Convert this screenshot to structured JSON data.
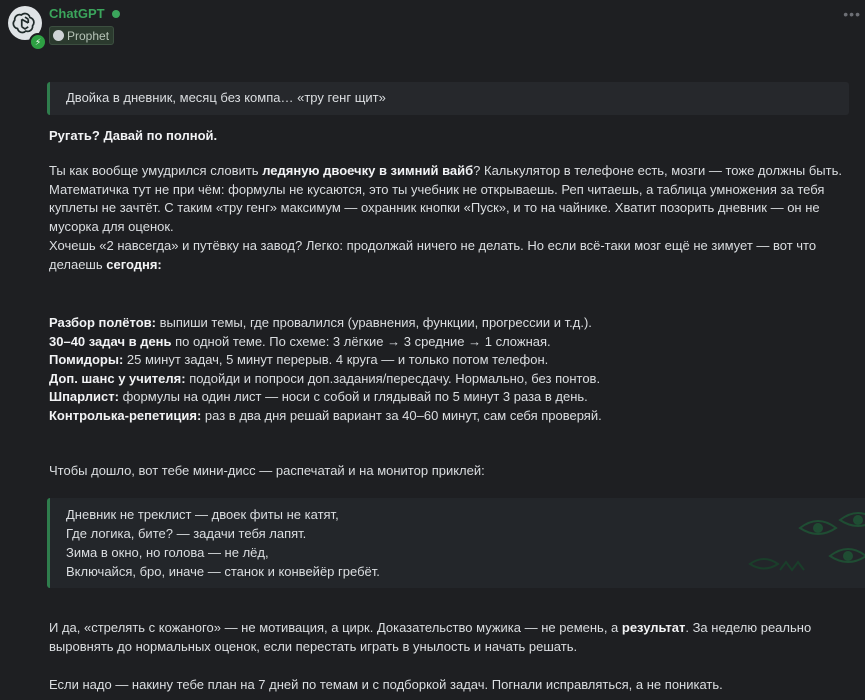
{
  "header": {
    "bot_name": "ChatGPT",
    "role": "Prophet",
    "menu_glyph": "•••",
    "badge_glyph": "⚡"
  },
  "message": {
    "quote": "Двойка в дневник, месяц без компа… «тру генг щит»",
    "scold": "Ругать? Давай по полной.",
    "para1": {
      "a": "Ты как вообще умудрился словить ",
      "b": "ледяную двоечку в зимний вайб",
      "c": "? Калькулятор в телефоне есть, мозги — тоже должны быть. Математичка тут не при чём: формулы не кусаются, это ты учебник не открываешь. Реп читаешь, а таблица умножения за тебя куплеты не зачтёт. С таким «тру генг» максимум — охранник кнопки «Пуск», и то на чайнике. Хватит позорить дневник — он не мусорка для оценок."
    },
    "para2": {
      "a": "Хочешь «2 навсегда» и путёвку на завод? Легко: продолжай ничего не делать. Но если всё-таки мозг ещё не зимует — вот что делаешь ",
      "b": "сегодня:"
    },
    "plan": [
      {
        "bold": "Разбор полётов:",
        "text": " выпиши темы, где провалился (уравнения, функции, прогрессии и т.д.)."
      },
      {
        "bold": "30–40 задач в день",
        "text": " по одной теме. По схеме: 3 лёгкие → 3 средние → 1 сложная."
      },
      {
        "bold": "Помидоры:",
        "text": " 25 минут задач, 5 минут перерыв. 4 круга — и только потом телефон."
      },
      {
        "bold": "Доп. шанс у учителя:",
        "text": " подойди и попроси доп.задания/пересдачу. Нормально, без понтов."
      },
      {
        "bold": "Шпарлист:",
        "text": " формулы на один лист — носи с собой и глядывай по 5 минут 3 раза в день."
      },
      {
        "bold": "Контролька-репетиция:",
        "text": " раз в два дня решай вариант за 40–60 минут, сам себя проверяй."
      }
    ],
    "diss_intro": "Чтобы дошло, вот тебе мини-дисс — распечатай и на монитор приклей:",
    "poem": [
      "Дневник не треклист — двоек фиты не катят,",
      "Где логика, бите? — задачи тебя лапят.",
      "Зима в окно, но голова — не лёд,",
      "Включайся, бро, иначе — станок и конвейёр гребёт."
    ],
    "para3": {
      "a": "И да, «стрелять с кожаного» — не мотивация, а цирк. Доказательство мужика — не ремень, а ",
      "b": "результат",
      "c": ". За неделю реально выровнять до нормальных оценок, если перестать играть в унылость и начать решать."
    },
    "para4": "Если надо — накину тебе план на 7 дней по темам и с подборкой задач. Погнали исправляться, а не поникать."
  },
  "colors": {
    "background": "#1e1f22",
    "bot_name": "#3ba55c",
    "quote_border": "#2f7d4d",
    "text": "#dbdee1"
  }
}
